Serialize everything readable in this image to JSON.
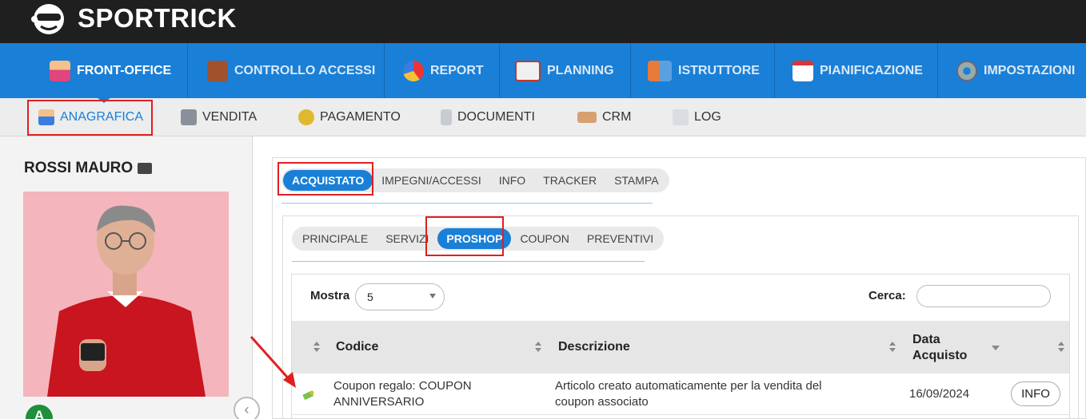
{
  "app": {
    "brand": "SPORTRICK"
  },
  "main_nav": {
    "items": [
      {
        "label": "FRONT-OFFICE",
        "icon": "user-icon"
      },
      {
        "label": "CONTROLLO ACCESSI",
        "icon": "door-icon"
      },
      {
        "label": "REPORT",
        "icon": "pie-chart-icon"
      },
      {
        "label": "PLANNING",
        "icon": "calendar-grid-icon"
      },
      {
        "label": "ISTRUTTORE",
        "icon": "group-icon"
      },
      {
        "label": "PIANIFICAZIONE",
        "icon": "calendar-icon"
      },
      {
        "label": "IMPOSTAZIONI",
        "icon": "gear-icon"
      }
    ]
  },
  "sub_nav": {
    "items": [
      {
        "label": "ANAGRAFICA",
        "icon": "user-icon"
      },
      {
        "label": "VENDITA",
        "icon": "cash-register-icon"
      },
      {
        "label": "PAGAMENTO",
        "icon": "coin-icon"
      },
      {
        "label": "DOCUMENTI",
        "icon": "document-icon"
      },
      {
        "label": "CRM",
        "icon": "handshake-icon"
      },
      {
        "label": "LOG",
        "icon": "note-icon"
      }
    ]
  },
  "customer": {
    "name": "ROSSI MAURO",
    "status_letter": "A"
  },
  "tabs_level1": [
    "ACQUISTATO",
    "IMPEGNI/ACCESSI",
    "INFO",
    "TRACKER",
    "STAMPA"
  ],
  "tabs_level2": [
    "PRINCIPALE",
    "SERVIZI",
    "PROSHOP",
    "COUPON",
    "PREVENTIVI"
  ],
  "table": {
    "show_label": "Mostra",
    "show_value": "5",
    "search_label": "Cerca:",
    "search_value": "",
    "headers": {
      "code": "Codice",
      "description": "Descrizione",
      "date_line1": "Data",
      "date_line2": "Acquisto"
    },
    "rows": [
      {
        "code_line1": "Coupon regalo: COUPON",
        "code_line2": "ANNIVERSARIO",
        "desc_line1": "Articolo creato automaticamente per la vendita del",
        "desc_line2": "coupon associato",
        "date": "16/09/2024",
        "action": "INFO"
      }
    ]
  },
  "colors": {
    "primary": "#1a7fd6",
    "header_bg": "#1f1f1f",
    "highlight": "#e02020"
  }
}
